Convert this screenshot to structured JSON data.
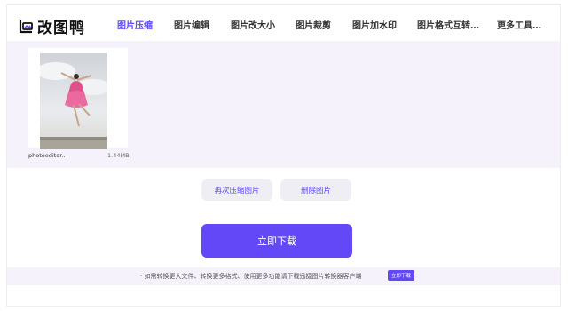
{
  "header": {
    "logo_text": "改图鸭",
    "nav": [
      {
        "label": "图片压缩",
        "active": true
      },
      {
        "label": "图片编辑",
        "active": false
      },
      {
        "label": "图片改大小",
        "active": false
      },
      {
        "label": "图片裁剪",
        "active": false
      },
      {
        "label": "图片加水印",
        "active": false
      },
      {
        "label": "图片格式互转…",
        "active": false
      },
      {
        "label": "更多工具…",
        "active": false
      }
    ]
  },
  "gallery": {
    "files": [
      {
        "name": "photoeditor..",
        "size": "1.44MB"
      }
    ]
  },
  "actions": {
    "recompress_label": "再次压缩图片",
    "delete_label": "删除图片",
    "download_label": "立即下载"
  },
  "footer": {
    "notice": "· 如需转换更大文件、转换更多格式、使用更多功能请下载迅捷图片转换器客户端",
    "download_button": "立即下载"
  },
  "colors": {
    "accent": "#5b4bf5",
    "primary_button": "#6248f6",
    "panel_bg": "#f6f2fb"
  }
}
